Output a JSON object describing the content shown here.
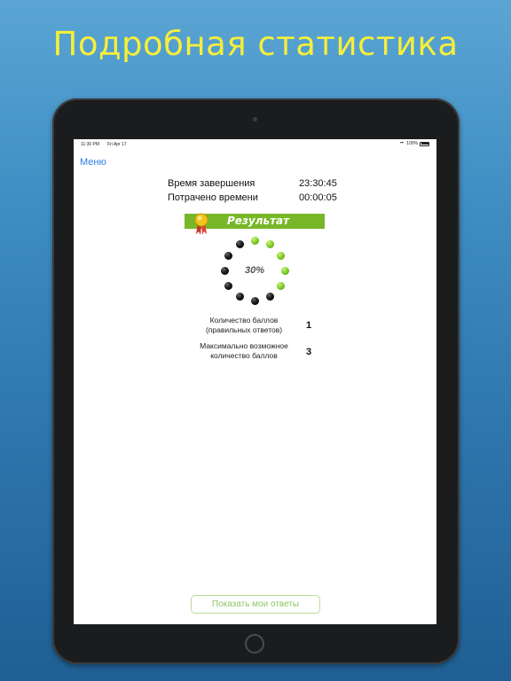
{
  "headline": "Подробная статистика",
  "status_bar": {
    "time": "11:30 PM",
    "date": "Fri Apr 17",
    "battery": "100%"
  },
  "nav": {
    "menu_label": "Меню"
  },
  "times": {
    "finish_label": "Время завершения",
    "finish_value": "23:30:45",
    "spent_label": "Потрачено времени",
    "spent_value": "00:00:05"
  },
  "result": {
    "banner_label": "Результат",
    "percent_text": "30%",
    "correct_fraction": 0.3,
    "dots_total": 12,
    "dots_lit": 5
  },
  "scores": {
    "points_label_1": "Количество баллов",
    "points_label_2": "(правильных ответов)",
    "points_value": "1",
    "max_label_1": "Максимально возможное",
    "max_label_2": "количество баллов",
    "max_value": "3"
  },
  "actions": {
    "show_answers_label": "Показать мои ответы"
  },
  "colors": {
    "headline": "#f6ef3a",
    "accent_green": "#77b728",
    "link_blue": "#2f7fe0"
  }
}
